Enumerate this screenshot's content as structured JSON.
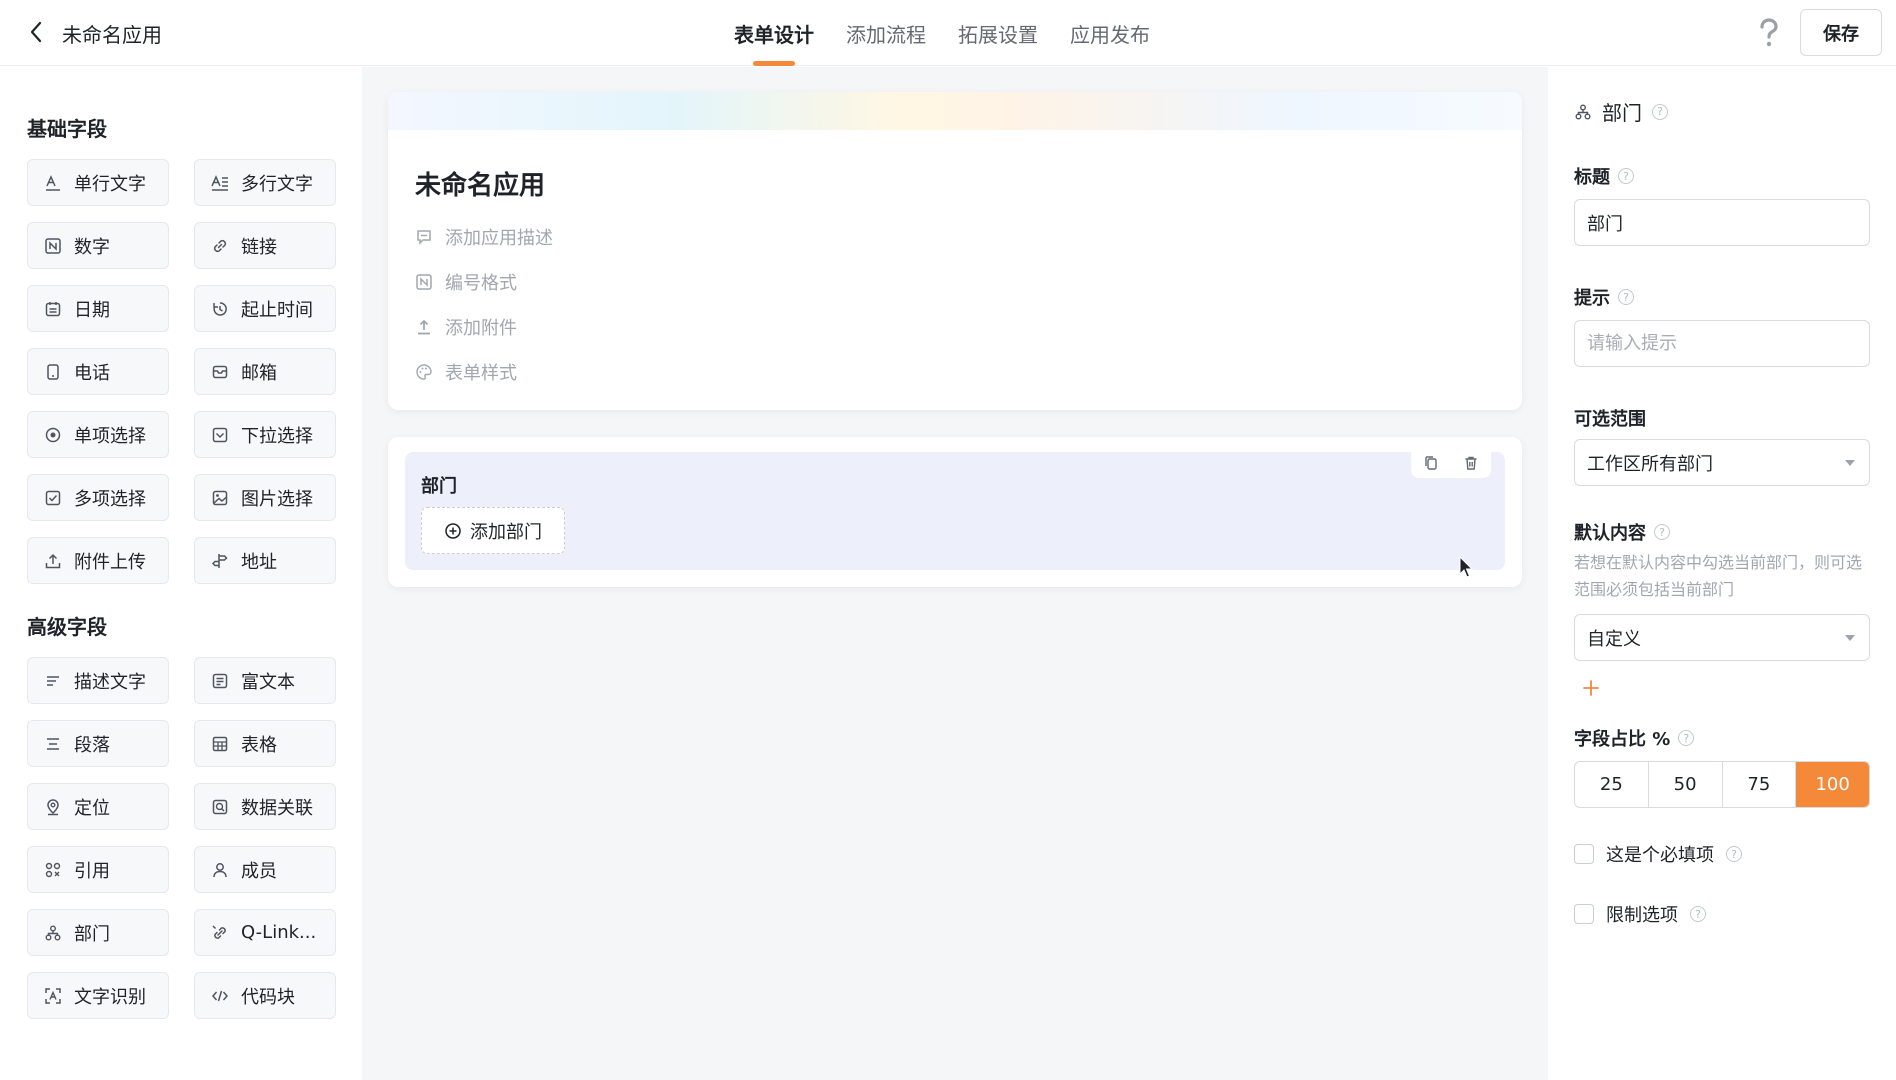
{
  "header": {
    "app_title": "未命名应用",
    "tabs": [
      {
        "label": "表单设计"
      },
      {
        "label": "添加流程"
      },
      {
        "label": "拓展设置"
      },
      {
        "label": "应用发布"
      }
    ],
    "active_tab": 0,
    "save_label": "保存"
  },
  "left": {
    "basic_title": "基础字段",
    "basic_fields": [
      "单行文字",
      "多行文字",
      "数字",
      "链接",
      "日期",
      "起止时间",
      "电话",
      "邮箱",
      "单项选择",
      "下拉选择",
      "多项选择",
      "图片选择",
      "附件上传",
      "地址"
    ],
    "advanced_title": "高级字段",
    "advanced_fields": [
      "描述文字",
      "富文本",
      "段落",
      "表格",
      "定位",
      "数据关联",
      "引用",
      "成员",
      "部门",
      "Q-Link...",
      "文字识别",
      "代码块"
    ]
  },
  "canvas": {
    "form_title": "未命名应用",
    "meta": [
      "添加应用描述",
      "编号格式",
      "添加附件",
      "表单样式"
    ],
    "field_label": "部门",
    "add_button": "添加部门"
  },
  "right": {
    "header": "部门",
    "title_label": "标题",
    "title_value": "部门",
    "hint_label": "提示",
    "hint_placeholder": "请输入提示",
    "range_label": "可选范围",
    "range_value": "工作区所有部门",
    "default_label": "默认内容",
    "default_hint": "若想在默认内容中勾选当前部门，则可选范围必须包括当前部门",
    "default_value": "自定义",
    "ratio_label": "字段占比 %",
    "ratio_options": [
      "25",
      "50",
      "75",
      "100"
    ],
    "ratio_selected": "100",
    "required_label": "这是个必填项",
    "limit_label": "限制选项"
  },
  "colors": {
    "accent": "#f5893a",
    "field_block_bg": "#edf0fb",
    "canvas_bg": "#f5f6f8"
  }
}
